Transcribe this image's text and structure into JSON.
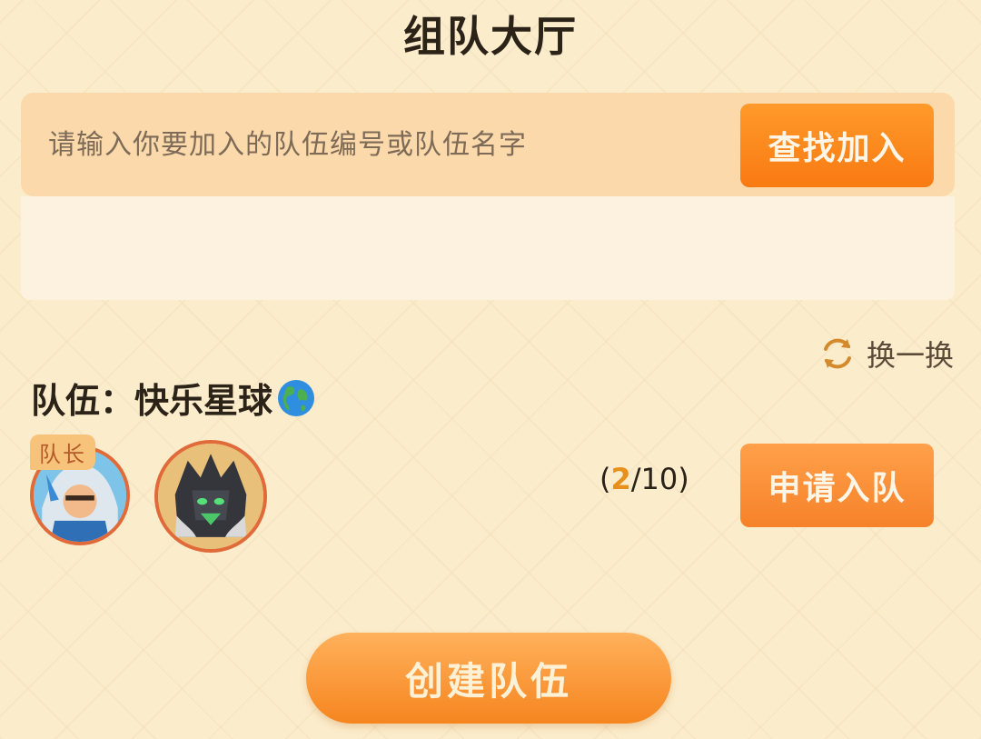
{
  "title": "组队大厅",
  "search": {
    "placeholder": "请输入你要加入的队伍编号或队伍名字",
    "button_label": "查找加入"
  },
  "refresh": {
    "label": "换一换",
    "icon": "refresh-icon"
  },
  "team": {
    "name": "队伍：快乐星球",
    "name_icon": "globe-icon",
    "captain_badge": "队长",
    "members": [
      {
        "role": "captain",
        "icon": "hero-avatar-blue"
      },
      {
        "role": "member",
        "icon": "hero-avatar-dark"
      }
    ],
    "count_current": "2",
    "count_total": "/10)",
    "count_open": "(",
    "apply_label": "申请入队"
  },
  "create_label": "创建队伍",
  "colors": {
    "accent": "#f97a12",
    "background": "#fbeccb",
    "search_bar": "#fbd9aa",
    "count_highlight": "#e8901c"
  }
}
